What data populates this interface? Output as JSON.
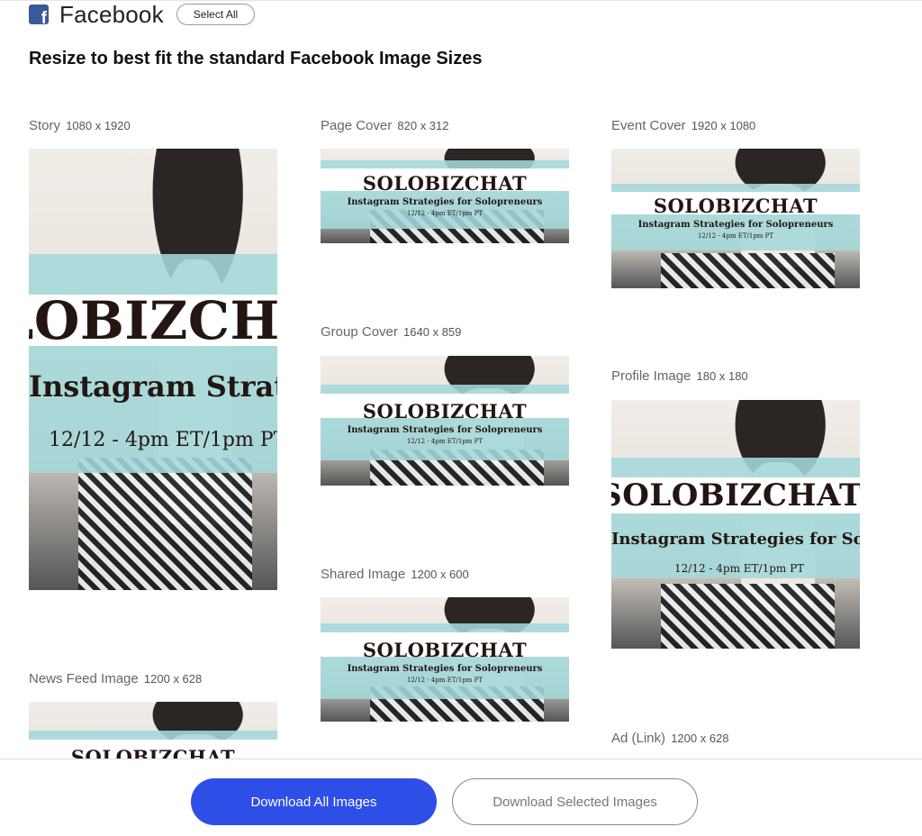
{
  "header": {
    "icon": "facebook-icon",
    "title": "Facebook",
    "select_all_label": "Select All"
  },
  "subtitle": "Resize to best fit the standard Facebook Image Sizes",
  "image_text": {
    "line1": "SOLOBIZCHAT",
    "line2": "Instagram Strategies for Solopreneurs",
    "line3": "12/12 - 4pm ET/1pm PT"
  },
  "sizes": [
    {
      "name": "Story",
      "dims": "1080 x 1920"
    },
    {
      "name": "Page Cover",
      "dims": "820 x 312"
    },
    {
      "name": "Event Cover",
      "dims": "1920 x 1080"
    },
    {
      "name": "Group Cover",
      "dims": "1640 x 859"
    },
    {
      "name": "Profile Image",
      "dims": "180 x 180"
    },
    {
      "name": "Shared Image",
      "dims": "1200 x 600"
    },
    {
      "name": "News Feed Image",
      "dims": "1200 x 628"
    },
    {
      "name": "Ad (Link)",
      "dims": "1200 x 628"
    }
  ],
  "footer": {
    "download_all_label": "Download All Images",
    "download_selected_label": "Download Selected Images"
  },
  "colors": {
    "primary_button": "#2e4ee8",
    "facebook_blue": "#3b5998",
    "banner_teal": "#a4d8db"
  }
}
